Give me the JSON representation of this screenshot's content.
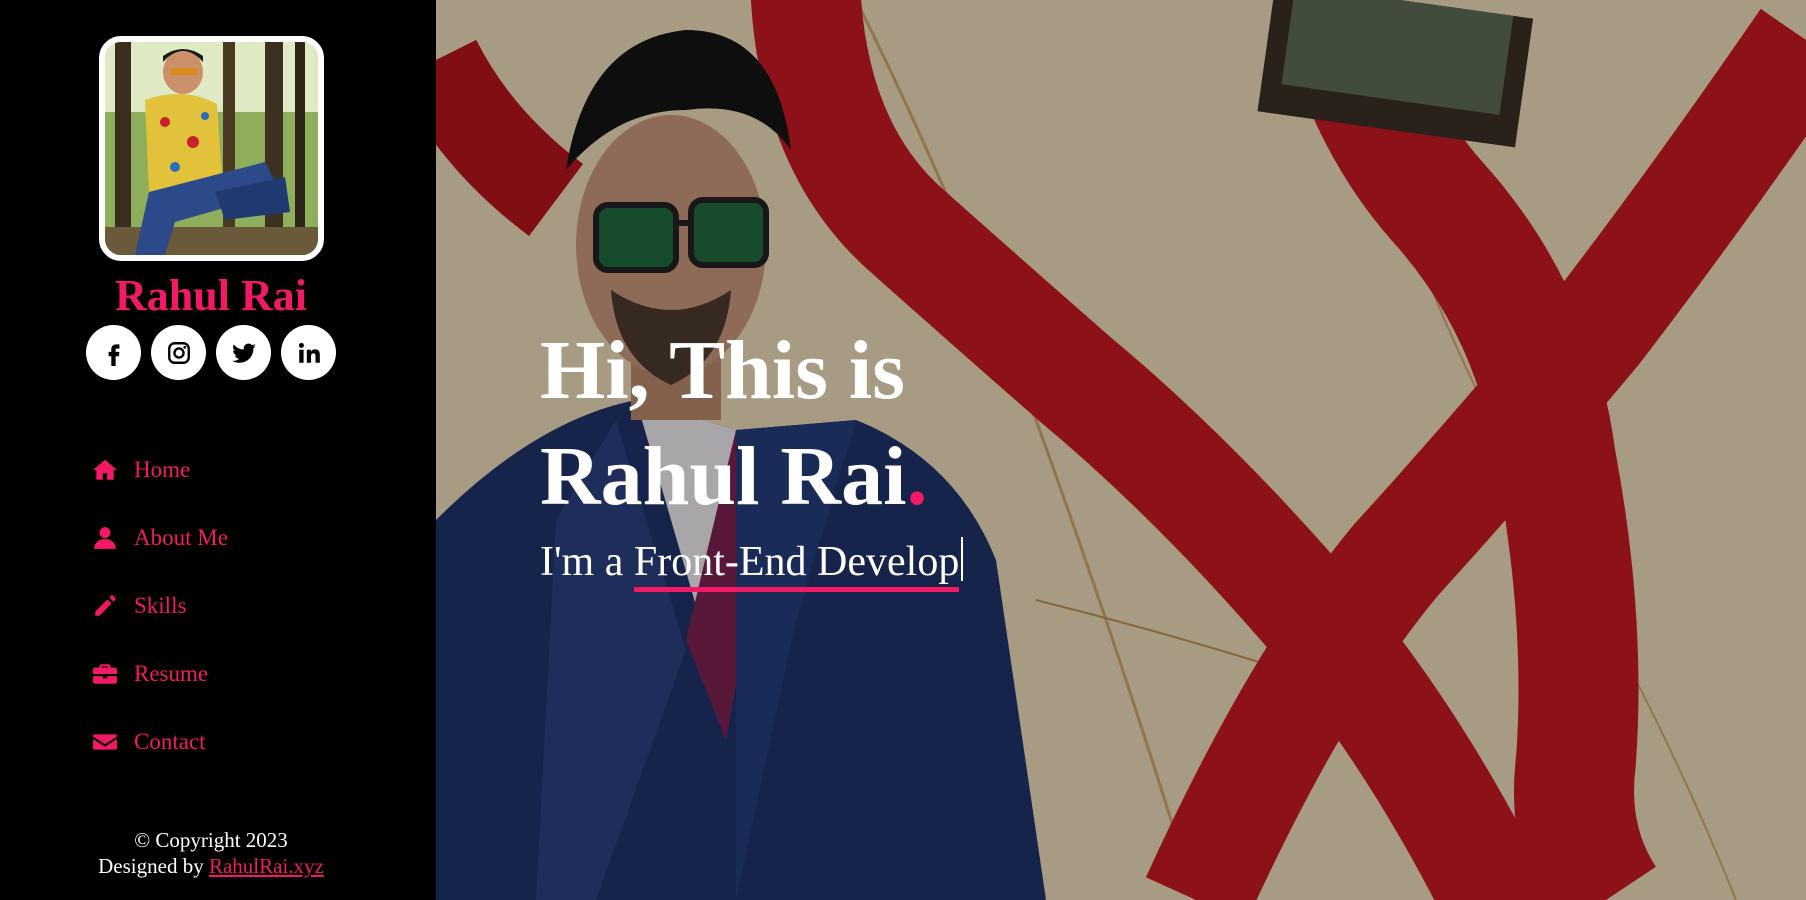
{
  "profile": {
    "name": "Rahul Rai"
  },
  "socials": [
    {
      "icon": "facebook-icon"
    },
    {
      "icon": "instagram-icon"
    },
    {
      "icon": "twitter-icon"
    },
    {
      "icon": "linkedin-icon"
    }
  ],
  "nav": {
    "items": [
      {
        "label": "Home",
        "icon": "home-icon"
      },
      {
        "label": "About Me",
        "icon": "user-icon"
      },
      {
        "label": "Skills",
        "icon": "pencil-icon"
      },
      {
        "label": "Resume",
        "icon": "briefcase-icon"
      },
      {
        "label": "Contact",
        "icon": "envelope-icon"
      }
    ]
  },
  "footer": {
    "copyright": "© Copyright 2023",
    "designed_by": "Designed by",
    "link_text": "RahulRai.xyz"
  },
  "hero": {
    "line1": "Hi, This is",
    "line2": "Rahul Rai",
    "dot": ".",
    "sub_prefix": "I'm a",
    "typed_text": "Front-End Develop"
  },
  "colors": {
    "accent": "#f21a66",
    "sidebar_bg": "#000000",
    "text": "#ffffff"
  }
}
